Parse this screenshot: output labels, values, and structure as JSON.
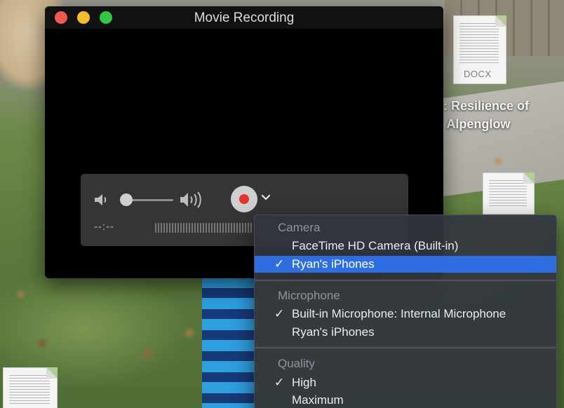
{
  "window": {
    "title": "Movie Recording",
    "timecode": "--:--"
  },
  "desktop": {
    "docx_badge": "DOCX",
    "file_label": ": Resilience of\n Alpenglow"
  },
  "menu": {
    "sections": [
      {
        "header": "Camera",
        "items": [
          {
            "label": "FaceTime HD Camera (Built-in)",
            "checked": false,
            "highlighted": false
          },
          {
            "label": "Ryan's iPhones",
            "checked": true,
            "highlighted": true
          }
        ]
      },
      {
        "header": "Microphone",
        "items": [
          {
            "label": "Built-in Microphone: Internal Microphone",
            "checked": true,
            "highlighted": false
          },
          {
            "label": "Ryan's iPhones",
            "checked": false,
            "highlighted": false
          }
        ]
      },
      {
        "header": "Quality",
        "items": [
          {
            "label": "High",
            "checked": true,
            "highlighted": false
          },
          {
            "label": "Maximum",
            "checked": false,
            "highlighted": false
          }
        ]
      }
    ],
    "check_glyph": "✓"
  },
  "colors": {
    "close": "#ee5a52",
    "minimize": "#f5bd2e",
    "zoom": "#2fc840",
    "record": "#e8322d",
    "selection": "#2f6ee0"
  },
  "icons": {
    "volume_low": "speaker-low-icon",
    "volume_high": "speaker-high-icon",
    "record": "record-icon",
    "options": "chevron-down-icon"
  }
}
